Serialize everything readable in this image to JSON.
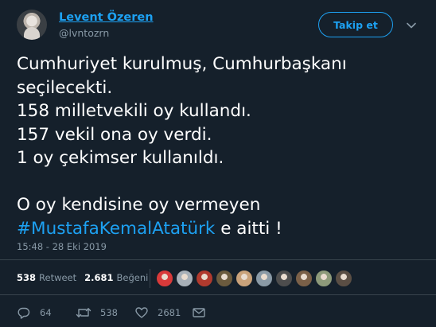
{
  "author": {
    "name": "Levent Özeren",
    "handle": "@lvntozrn"
  },
  "follow_button": {
    "label": "Takip et"
  },
  "tweet": {
    "lines": [
      "Cumhuriyet kurulmuş, Cumhurbaşkanı",
      "seçilecekti.",
      "158 milletvekili oy kullandı.",
      "157 vekil ona oy verdi.",
      "1 oy çekimser kullanıldı."
    ],
    "line_after_blank": "O oy kendisine oy vermeyen",
    "hashtag": "#MustafaKemalAtatürk",
    "hashtag_suffix": " e aitti !",
    "timestamp": "15:48 - 28 Eki 2019"
  },
  "stats": {
    "retweets": {
      "count": "538",
      "label": "Retweet"
    },
    "likes": {
      "count": "2.681",
      "label": "Beğeni"
    }
  },
  "liker_avatars": [
    {
      "name": "liker-avatar-1",
      "color": "#d83a3a"
    },
    {
      "name": "liker-avatar-2",
      "color": "#a7b0b8"
    },
    {
      "name": "liker-avatar-3",
      "color": "#b03a2e"
    },
    {
      "name": "liker-avatar-4",
      "color": "#6b5b3e"
    },
    {
      "name": "liker-avatar-5",
      "color": "#c9a27a"
    },
    {
      "name": "liker-avatar-6",
      "color": "#8a9aa6"
    },
    {
      "name": "liker-avatar-7",
      "color": "#4d4d4d"
    },
    {
      "name": "liker-avatar-8",
      "color": "#7a6048"
    },
    {
      "name": "liker-avatar-9",
      "color": "#8d9a7a"
    },
    {
      "name": "liker-avatar-10",
      "color": "#5a4e44"
    }
  ],
  "actions": {
    "reply": {
      "icon": "reply-icon",
      "count": "64"
    },
    "retweet": {
      "icon": "retweet-icon",
      "count": "538"
    },
    "like": {
      "icon": "heart-icon",
      "count": "2681"
    },
    "dm": {
      "icon": "envelope-icon"
    }
  },
  "colors": {
    "background": "#15202b",
    "accent": "#1da1f2",
    "muted": "#8899a6",
    "divider": "#38444d"
  }
}
